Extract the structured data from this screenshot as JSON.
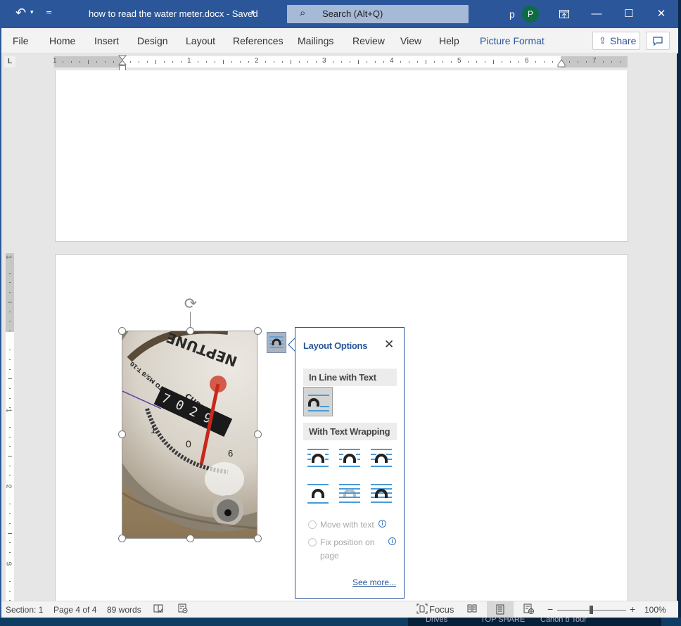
{
  "titlebar": {
    "undo_icon": "undo-icon",
    "undo_dropdown": "chevron-down-icon",
    "customize_qat": "customize-quick-access-icon",
    "doc_title": "how to read the water meter.docx  -  Saved",
    "saved_caret": "▾",
    "search_placeholder": "Search (Alt+Q)",
    "user_initial": "p",
    "avatar_initial": "P",
    "ribbon_display_icon": "⊡",
    "minimize": "—",
    "maximize": "☐",
    "close": "✕"
  },
  "ribbon": {
    "tabs": [
      {
        "label": "File"
      },
      {
        "label": "Home"
      },
      {
        "label": "Insert"
      },
      {
        "label": "Design"
      },
      {
        "label": "Layout"
      },
      {
        "label": "References"
      },
      {
        "label": "Mailings"
      },
      {
        "label": "Review"
      },
      {
        "label": "View"
      },
      {
        "label": "Help"
      },
      {
        "label": "Picture Format"
      }
    ],
    "active_tab": "Picture Format",
    "share_label": "Share"
  },
  "ruler": {
    "tab_selector": "L",
    "h_numbers": [
      "1",
      "1",
      "2",
      "3",
      "4",
      "5",
      "6",
      "7"
    ],
    "v_numbers": [
      "1",
      "1",
      "2",
      "3"
    ]
  },
  "picture": {
    "description": "Close-up photo of a Neptune water meter dial showing CUBIC FEET odometer and red sweep hand"
  },
  "layout_options": {
    "title": "Layout Options",
    "close": "✕",
    "inline_header": "In Line with Text",
    "wrapping_header": "With Text Wrapping",
    "wrap_options": [
      "Square",
      "Tight",
      "Through",
      "Top and Bottom",
      "Behind Text",
      "In Front of Text"
    ],
    "selected_option": "In Line with Text",
    "move_with_text": "Move with text",
    "fix_position": "Fix position on",
    "fix_position_2": "page",
    "info": "i",
    "see_more": "See more..."
  },
  "statusbar": {
    "section": "Section: 1",
    "page": "Page 4 of 4",
    "words": "89 words",
    "focus": "Focus",
    "zoom_minus": "−",
    "zoom_plus": "+",
    "zoom_level": "100%",
    "zoom_percent": 100
  },
  "taskbar": {
    "items": [
      "Drives",
      "TOP SHARE",
      "Canon b Tour"
    ]
  },
  "colors": {
    "accent": "#2b579a",
    "avatar": "#0f6b45",
    "wrap_line": "#4a9bd6"
  }
}
